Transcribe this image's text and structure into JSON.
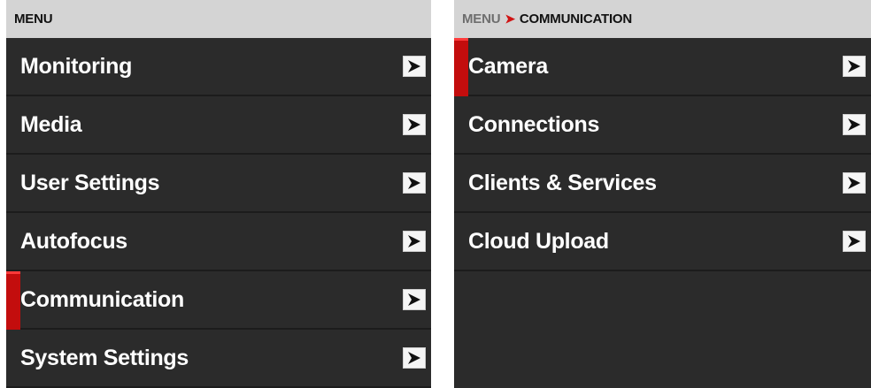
{
  "colors": {
    "panel_bg": "#2b2b2b",
    "header_bg": "#d4d4d4",
    "accent": "#c30d0d",
    "text": "#ffffff"
  },
  "left_panel": {
    "breadcrumb": {
      "root": "MENU"
    },
    "items": [
      {
        "label": "Monitoring",
        "icon": "chevron-right-icon",
        "selected": false
      },
      {
        "label": "Media",
        "icon": "chevron-right-icon",
        "selected": false
      },
      {
        "label": "User Settings",
        "icon": "chevron-right-icon",
        "selected": false
      },
      {
        "label": "Autofocus",
        "icon": "chevron-right-icon",
        "selected": false
      },
      {
        "label": "Communication",
        "icon": "chevron-right-icon",
        "selected": true
      },
      {
        "label": "System Settings",
        "icon": "chevron-right-icon",
        "selected": false
      }
    ]
  },
  "right_panel": {
    "breadcrumb": {
      "root": "MENU",
      "separator": "➤",
      "current": "COMMUNICATION"
    },
    "items": [
      {
        "label": "Camera",
        "icon": "chevron-right-icon",
        "selected": true
      },
      {
        "label": "Connections",
        "icon": "chevron-right-icon",
        "selected": false
      },
      {
        "label": "Clients & Services",
        "icon": "chevron-right-icon",
        "selected": false
      },
      {
        "label": "Cloud Upload",
        "icon": "chevron-right-icon",
        "selected": false
      }
    ]
  }
}
